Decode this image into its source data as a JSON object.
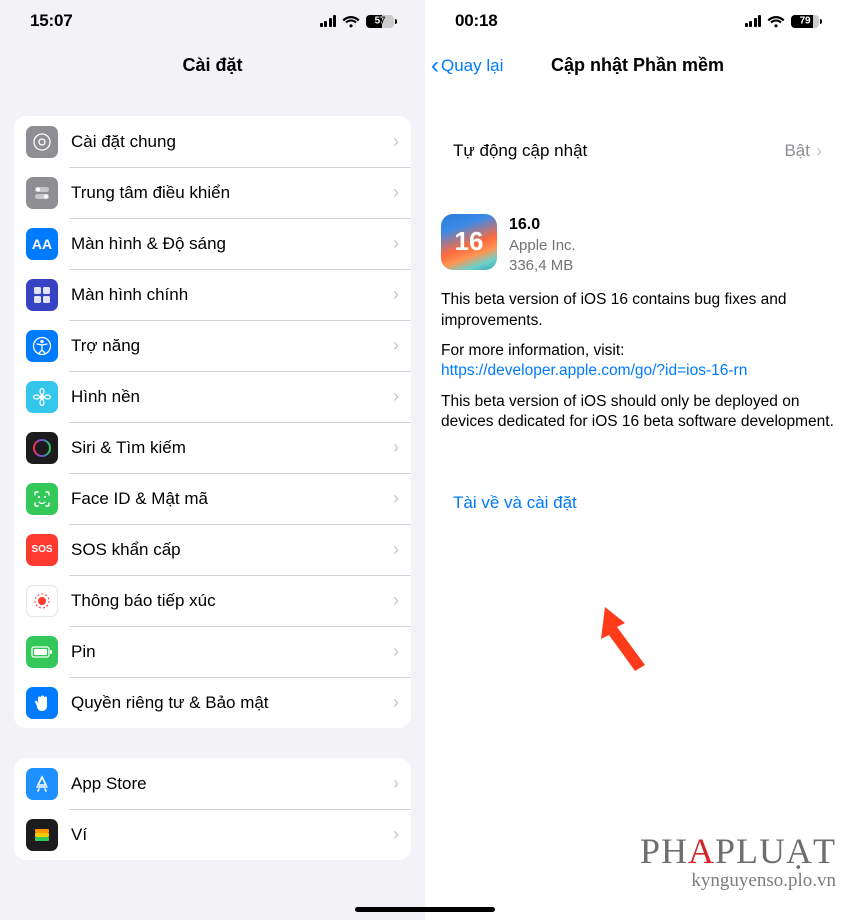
{
  "left": {
    "status_time": "15:07",
    "battery_pct": "57",
    "title": "Cài đặt",
    "groups": [
      {
        "rows": [
          {
            "id": "general",
            "label": "Cài đặt chung",
            "icon": "ic-general",
            "icon_name": "gear-icon"
          },
          {
            "id": "control-center",
            "label": "Trung tâm điều khiển",
            "icon": "ic-control",
            "icon_name": "switches-icon"
          },
          {
            "id": "display",
            "label": "Màn hình & Độ sáng",
            "icon": "ic-display",
            "icon_name": "display-aa-icon",
            "glyph": "AA"
          },
          {
            "id": "home-screen",
            "label": "Màn hình chính",
            "icon": "ic-home",
            "icon_name": "home-grid-icon"
          },
          {
            "id": "accessibility",
            "label": "Trợ năng",
            "icon": "ic-access",
            "icon_name": "accessibility-icon"
          },
          {
            "id": "wallpaper",
            "label": "Hình nền",
            "icon": "ic-wall",
            "icon_name": "flower-icon"
          },
          {
            "id": "siri",
            "label": "Siri & Tìm kiếm",
            "icon": "ic-siri",
            "icon_name": "siri-icon"
          },
          {
            "id": "faceid",
            "label": "Face ID & Mật mã",
            "icon": "ic-face",
            "icon_name": "faceid-icon"
          },
          {
            "id": "sos",
            "label": "SOS khẩn cấp",
            "icon": "ic-sos",
            "icon_name": "sos-icon",
            "glyph": "SOS"
          },
          {
            "id": "exposure",
            "label": "Thông báo tiếp xúc",
            "icon": "ic-expose",
            "icon_name": "exposure-icon"
          },
          {
            "id": "battery",
            "label": "Pin",
            "icon": "ic-batt",
            "icon_name": "battery-icon"
          },
          {
            "id": "privacy",
            "label": "Quyền riêng tư & Bảo mật",
            "icon": "ic-priv",
            "icon_name": "hand-icon"
          }
        ]
      },
      {
        "rows": [
          {
            "id": "appstore",
            "label": "App Store",
            "icon": "ic-appstore",
            "icon_name": "appstore-icon"
          },
          {
            "id": "wallet",
            "label": "Ví",
            "icon": "ic-wallet",
            "icon_name": "wallet-icon"
          }
        ]
      }
    ]
  },
  "right": {
    "status_time": "00:18",
    "battery_pct": "79",
    "back_label": "Quay lại",
    "title": "Cập nhật Phần mềm",
    "auto_update_label": "Tự động cập nhật",
    "auto_update_value": "Bật",
    "update": {
      "icon_text": "16",
      "version": "16.0",
      "vendor": "Apple Inc.",
      "size": "336,4 MB",
      "desc1": "This beta version of iOS 16 contains bug fixes and improvements.",
      "more_prefix": "For more information, visit:",
      "more_link": "https://developer.apple.com/go/?id=ios-16-rn",
      "desc2": "This beta version of iOS should only be deployed on devices dedicated for iOS 16 beta software development."
    },
    "action_label": "Tài về và cài đặt"
  },
  "watermark": {
    "brand_pre": "PH",
    "brand_accent": "A",
    "brand_post": "PLUẠT",
    "sub": "kynguyenso.plo.vn"
  }
}
